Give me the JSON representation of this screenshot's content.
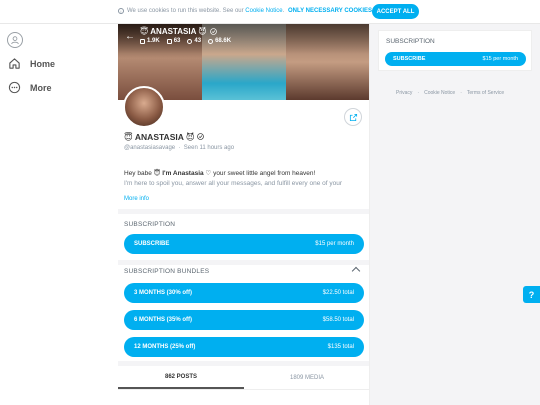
{
  "cookie": {
    "message": "We use cookies to run this website. See our ",
    "link": "Cookie Notice",
    "suffix": ".",
    "only_necessary": "ONLY NECESSARY COOKIES",
    "accept": "ACCEPT ALL"
  },
  "sidebar": {
    "items": [
      {
        "label": "Home",
        "icon": "home-icon"
      },
      {
        "label": "More",
        "icon": "more-icon"
      }
    ]
  },
  "profile": {
    "cover_name": "😇 ANASTASIA 😈",
    "stats": {
      "photos": "1.9K",
      "videos": "63",
      "streams": "43",
      "likes": "68.6K"
    },
    "name": "😇 ANASTASIA 😈",
    "handle": "@anastasiasavage",
    "seen": "Seen 11 hours ago",
    "bio_line1_pre": "Hey babe 😇 ",
    "bio_line1_bold": "I'm Anastasia",
    "bio_line1_post": " ♡ your sweet little angel from heaven!",
    "bio_line2": "I'm here to spoil you, answer all your messages, and fulfill every one of your",
    "more_info": "More info"
  },
  "subscription": {
    "title": "SUBSCRIPTION",
    "button_label": "SUBSCRIBE",
    "price": "$15 per month"
  },
  "bundles": {
    "title": "SUBSCRIPTION BUNDLES",
    "items": [
      {
        "label": "3 MONTHS (30% off)",
        "total": "$22.50 total"
      },
      {
        "label": "6 MONTHS (35% off)",
        "total": "$58.50 total"
      },
      {
        "label": "12 MONTHS (25% off)",
        "total": "$135 total"
      }
    ]
  },
  "tabs": {
    "posts": "862 POSTS",
    "media": "1809 MEDIA"
  },
  "right_panel": {
    "title": "SUBSCRIPTION",
    "button_label": "SUBSCRIBE",
    "price": "$15 per month",
    "links": [
      "Privacy",
      "Cookie Notice",
      "Terms of Service"
    ]
  },
  "help": {
    "label": "?"
  },
  "colors": {
    "accent": "#00aff0",
    "muted": "#8a96a3"
  }
}
